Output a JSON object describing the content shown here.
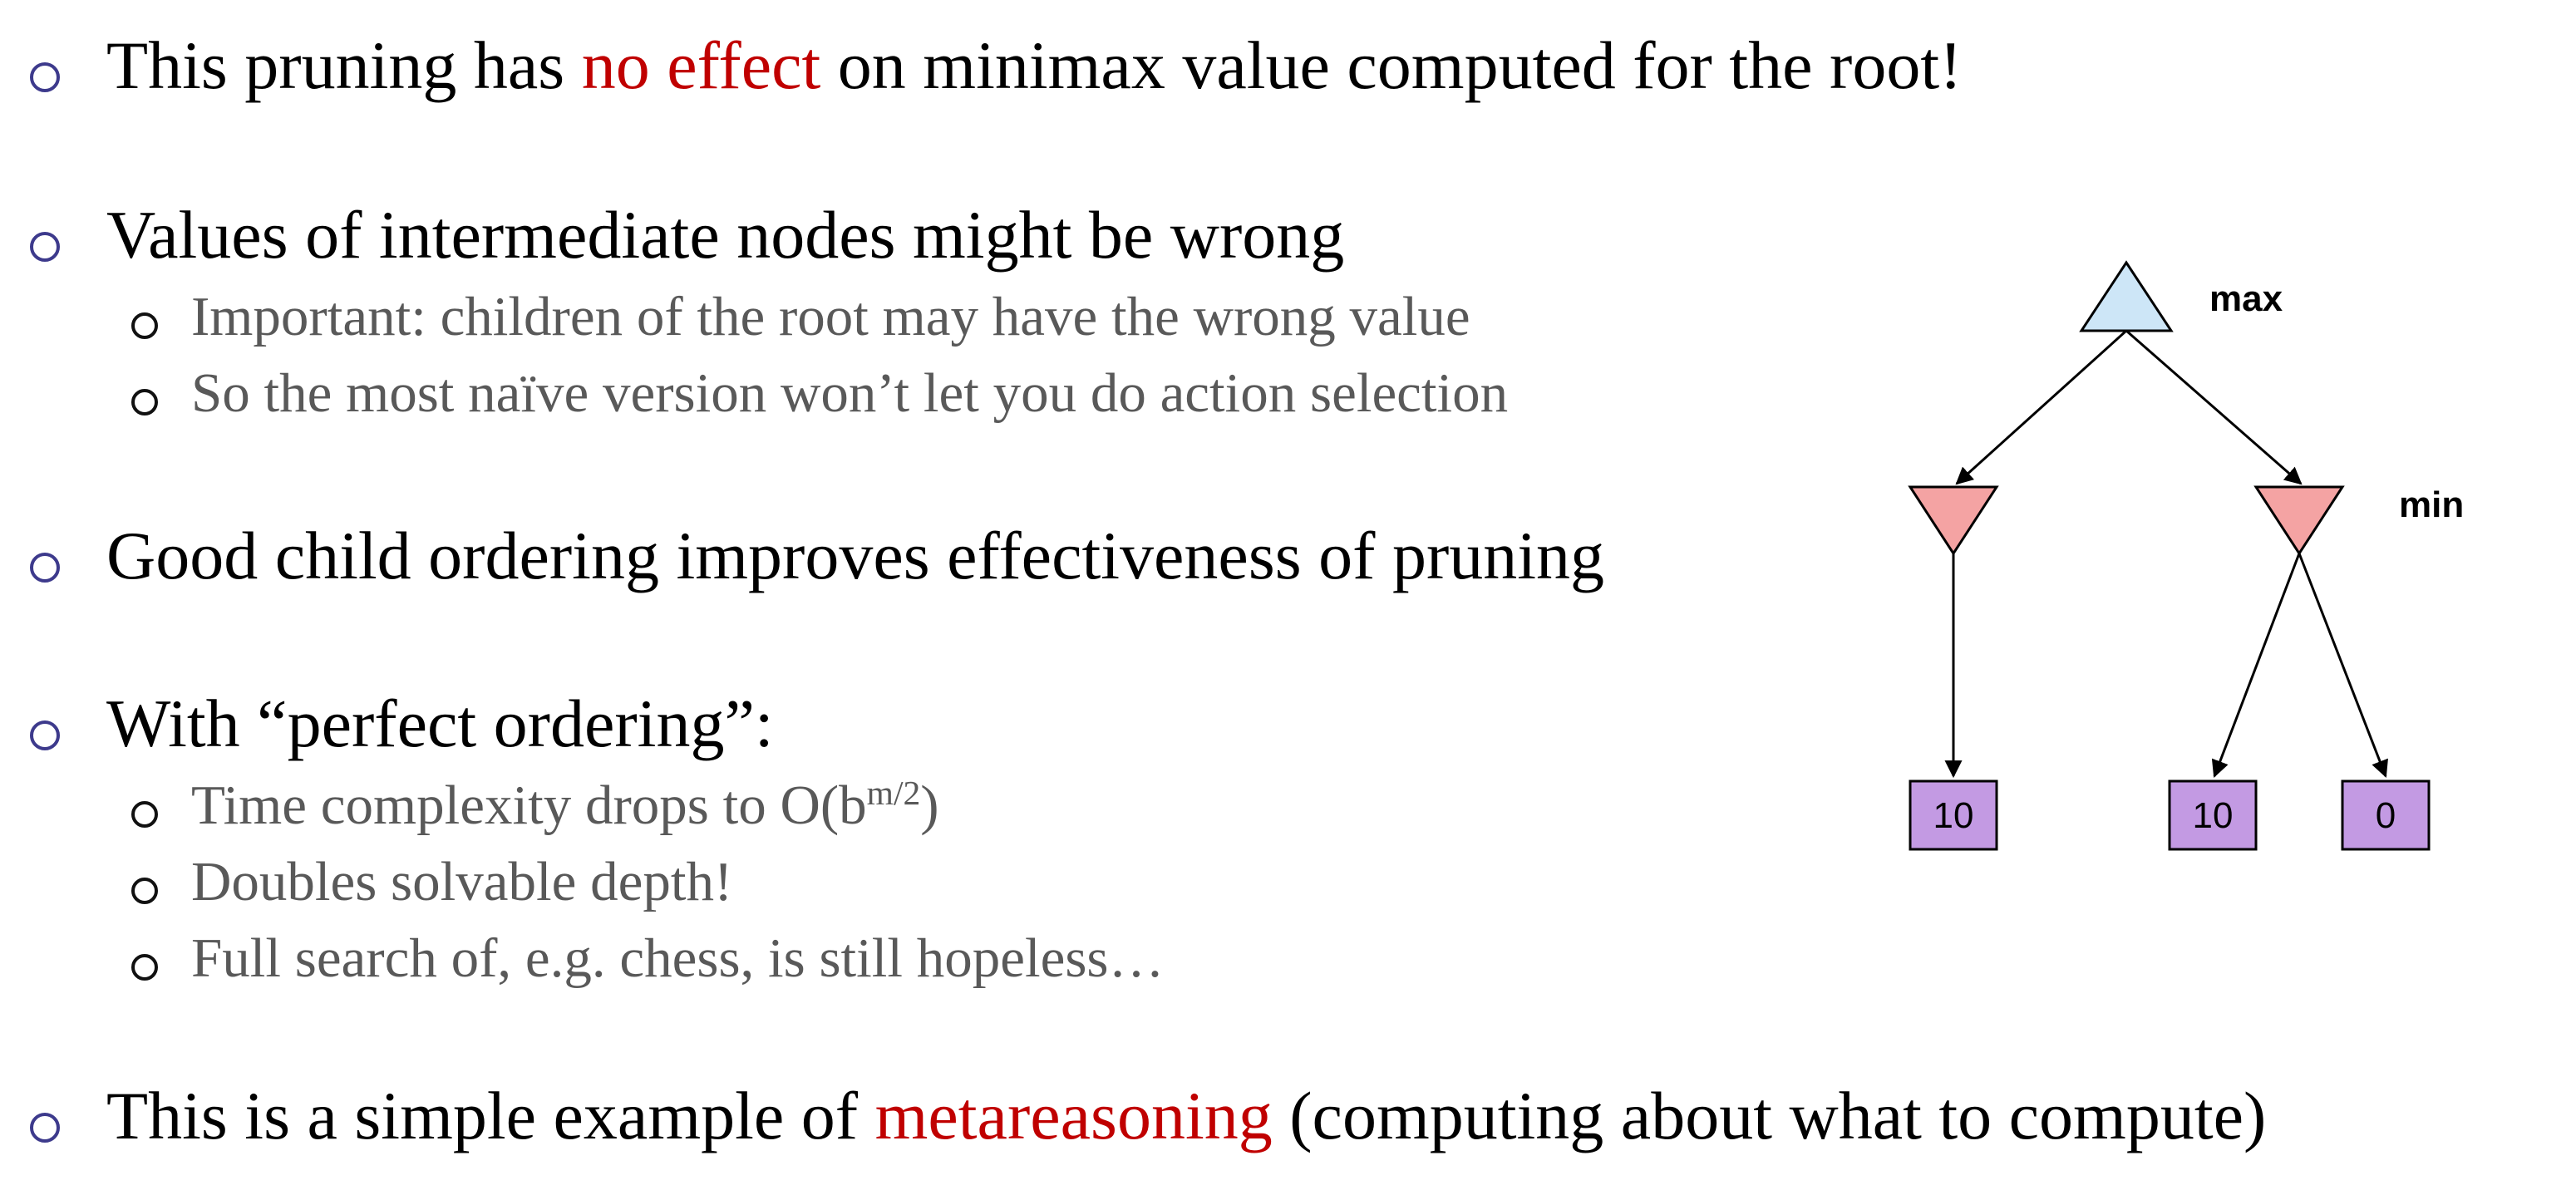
{
  "bullets": {
    "b1": {
      "pre": "This pruning has ",
      "highlight": "no effect",
      "post": " on minimax value computed for the root!"
    },
    "b2": {
      "text": "Values of intermediate nodes might be wrong"
    },
    "b2_sub1": {
      "text": "Important: children of the root may have the wrong value"
    },
    "b2_sub2": {
      "text": "So the most naïve version won’t let you do action selection"
    },
    "b3": {
      "text": "Good child ordering improves effectiveness of pruning"
    },
    "b4": {
      "text": "With “perfect ordering”:"
    },
    "b4_sub1": {
      "pre": "Time complexity drops to O(b",
      "sup": "m/2",
      "post": ")"
    },
    "b4_sub2": {
      "text": "Doubles solvable depth!"
    },
    "b4_sub3": {
      "text": "Full search of, e.g. chess, is still hopeless…"
    },
    "b5": {
      "pre": "This is a simple example of ",
      "highlight": "metareasoning",
      "post": " (computing about what to compute)"
    }
  },
  "tree": {
    "max_label": "max",
    "min_label": "min",
    "leaves": [
      "10",
      "10",
      "0"
    ],
    "colors": {
      "max_node": "#cde6f7",
      "min_node": "#f4a3a3",
      "leaf": "#c39ae3",
      "edge": "#000000"
    }
  },
  "colors": {
    "accent_red": "#c00000",
    "main_text": "#000000",
    "sub_text": "#595959",
    "bullet_ring": "#3d3a8c"
  }
}
